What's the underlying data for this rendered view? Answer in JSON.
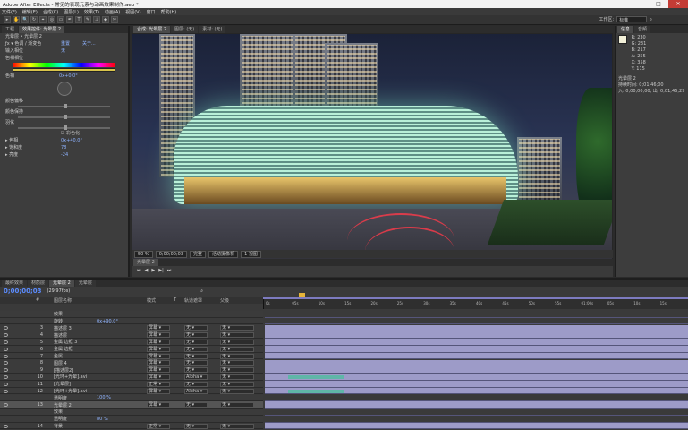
{
  "app": {
    "title": "Adobe After Effects - 常见的表现元素与动画效果制作.aep *"
  },
  "window_controls": {
    "minimize": "–",
    "maximize": "□",
    "close": "✕"
  },
  "menu": [
    "文件(F)",
    "编辑(E)",
    "合成(C)",
    "图层(L)",
    "效果(T)",
    "动画(A)",
    "视图(V)",
    "窗口",
    "帮助(H)"
  ],
  "toolbar": {
    "tools": [
      "▸",
      "✋",
      "🔍",
      "↻",
      "⌖",
      "◎",
      "▭",
      "✒",
      "T",
      "✎",
      "⊥",
      "◆",
      "✂"
    ],
    "workspace_label": "工作区:",
    "workspace_value": "标准",
    "search_icon": "search-icon"
  },
  "left_panel": {
    "tabs": [
      "工程",
      "效果控件: 光晕层 2"
    ],
    "subtitle": "光晕层 • 光晕层 2",
    "effect_name": "色调 / 渐变色",
    "effect_links": [
      "重置",
      "关于..."
    ],
    "rows": [
      {
        "label": "输入相位",
        "value": "无"
      },
      {
        "label": "色相相位",
        "value": ""
      },
      {
        "label": "色相",
        "value": "0x+0.0°"
      },
      {
        "label": "颜色偏移",
        "value": ""
      },
      {
        "label": "颜色保持",
        "value": ""
      },
      {
        "label": "羽化",
        "value": ""
      }
    ],
    "checkbox_label": "彩色化",
    "colorize_rows": [
      {
        "label": "色相",
        "value": "0x+40.0°"
      },
      {
        "label": "饱和度",
        "value": "78"
      },
      {
        "label": "亮度",
        "value": "-24"
      }
    ]
  },
  "viewer": {
    "tabs": [
      "合成: 光晕层 2",
      "图层: (无)",
      "素材: (无)"
    ],
    "bar": [
      "50 %",
      "0;00;00;03",
      "完整",
      "活动摄像机",
      "1 视图"
    ],
    "timeline_tab": "光晕层 2"
  },
  "right_panel": {
    "tabs": [
      "信息",
      "音频"
    ],
    "info": [
      "R: 230",
      "G: 231",
      "B: 217",
      "A: 255",
      "X: 358",
      "Y: 115"
    ],
    "layer_name": "光晕层 2",
    "durations": [
      "持续时间: 0;01;46;00",
      "入: 0;00;00;00, 出: 0;01;46;29"
    ]
  },
  "timeline": {
    "tabs": [
      "最终效果",
      "材质层",
      "光晕层 2",
      "光晕层"
    ],
    "timecode": "0;00;00;03",
    "fps": "(29.97fps)",
    "columns": [
      "#",
      "图层名称",
      "模式",
      "T",
      "轨道遮罩",
      "父级"
    ],
    "ruler": [
      "0s",
      "05s",
      "10s",
      "15s",
      "20s",
      "25s",
      "30s",
      "35s",
      "40s",
      "45s",
      "50s",
      "55s",
      "01:00s",
      "05s",
      "10s",
      "15s"
    ],
    "rows": [
      {
        "num": "",
        "name": "效果",
        "sub": true
      },
      {
        "num": "",
        "name": "旋转",
        "sub": true,
        "val": "0x+90.0°"
      },
      {
        "num": "3",
        "name": "描述层 3",
        "mode": "屏幕",
        "trk": "无",
        "par": "无"
      },
      {
        "num": "4",
        "name": "描述层",
        "mode": "屏幕",
        "trk": "无",
        "par": "无"
      },
      {
        "num": "5",
        "name": "金属 边框 3",
        "mode": "屏幕",
        "trk": "无",
        "par": "无"
      },
      {
        "num": "6",
        "name": "金属 边框",
        "mode": "屏幕",
        "trk": "无",
        "par": "无"
      },
      {
        "num": "7",
        "name": "金属",
        "mode": "屏幕",
        "trk": "无",
        "par": "无"
      },
      {
        "num": "8",
        "name": "图层 4",
        "mode": "屏幕",
        "trk": "无",
        "par": "无"
      },
      {
        "num": "9",
        "name": "[描述层2]",
        "mode": "屏幕",
        "trk": "无",
        "par": "无"
      },
      {
        "num": "10",
        "name": "[光环+光晕].avi",
        "mode": "屏幕",
        "trk": "Alpha",
        "par": "无"
      },
      {
        "num": "11",
        "name": "[光晕层]",
        "mode": "正常",
        "trk": "无",
        "par": "无"
      },
      {
        "num": "12",
        "name": "[光环+光晕].avi",
        "mode": "屏幕",
        "trk": "Alpha",
        "par": "无"
      },
      {
        "num": "",
        "name": "透明度",
        "sub": true,
        "val": "100 %"
      },
      {
        "num": "13",
        "name": "光晕层 2",
        "mode": "屏幕",
        "trk": "无",
        "par": "无",
        "sel": true
      },
      {
        "num": "",
        "name": "效果",
        "sub": true
      },
      {
        "num": "",
        "name": "透明度",
        "sub": true,
        "val": "80 %"
      },
      {
        "num": "14",
        "name": "背景",
        "mode": "正常",
        "trk": "无",
        "par": "无"
      }
    ]
  },
  "colors": {
    "accent": "#5b8cff",
    "layer_bar": "#9d9bc8",
    "playhead": "#e03030",
    "keyframe_bar": "#5fb6a8"
  }
}
